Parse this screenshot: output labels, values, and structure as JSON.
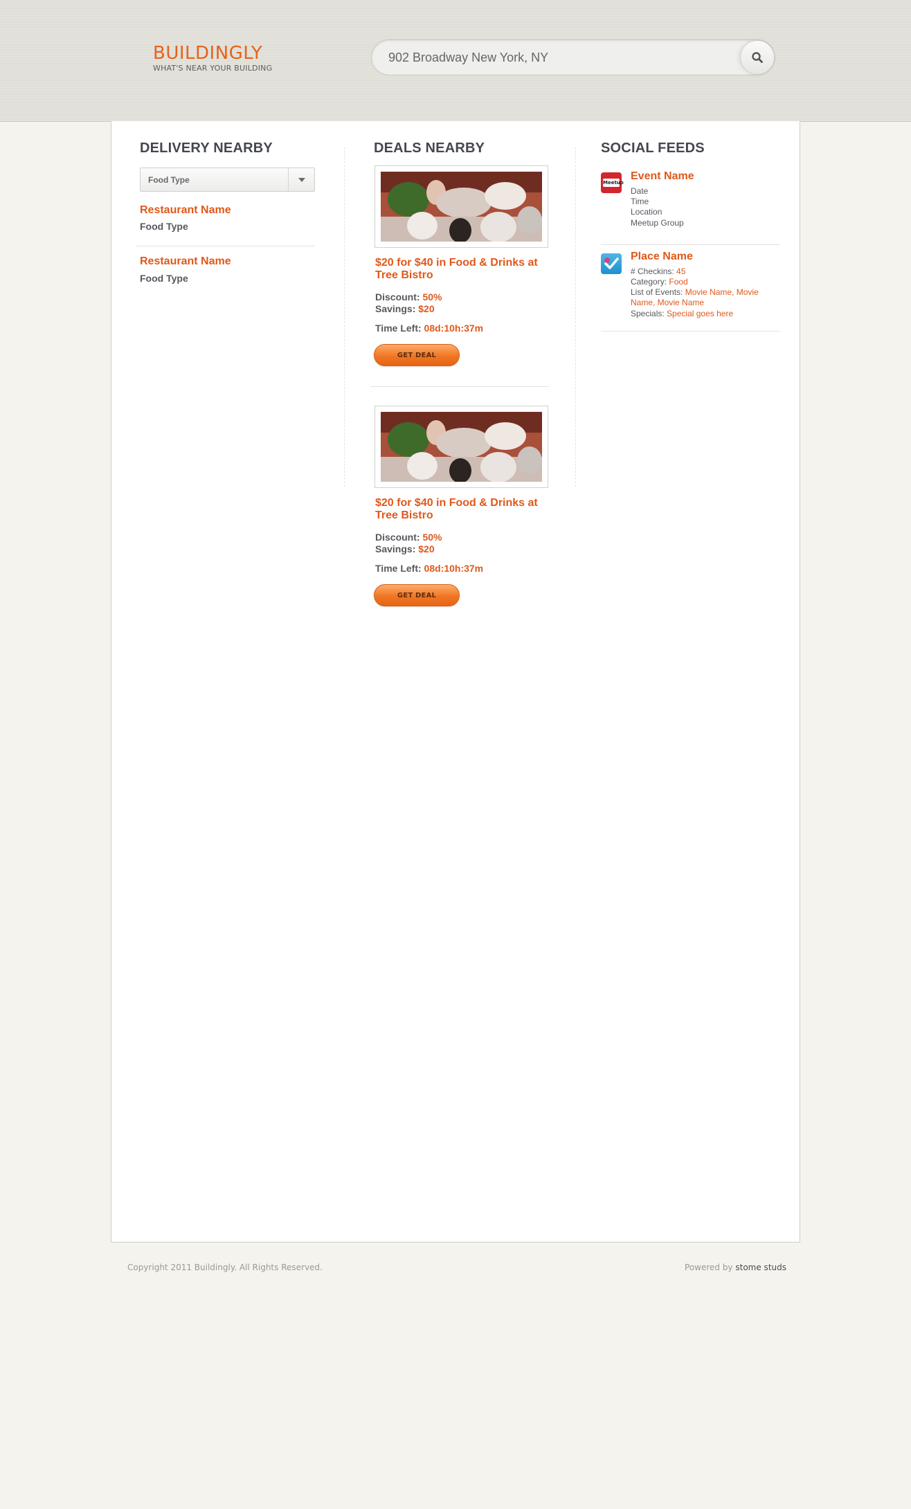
{
  "header": {
    "logo_title": "BUILDINGLY",
    "logo_tagline": "WHAT'S NEAR YOUR BUILDING",
    "search_value": "902 Broadway New York, NY",
    "search_icon": "search-icon"
  },
  "delivery": {
    "title": "DELIVERY NEARBY",
    "filter_label": "Food Type",
    "restaurants": [
      {
        "name": "Restaurant Name",
        "type": "Food Type"
      },
      {
        "name": "Restaurant Name",
        "type": "Food Type"
      }
    ]
  },
  "deals": {
    "title": "DEALS NEARBY",
    "items": [
      {
        "title": "$20 for $40 in Food & Drinks at Tree Bistro",
        "discount_label": "Discount:",
        "discount": "50%",
        "savings_label": "Savings:",
        "savings": "$20",
        "time_left_label": "Time Left:",
        "time_left": "08d:10h:37m",
        "button": "GET DEAL"
      },
      {
        "title": "$20 for $40 in Food & Drinks at Tree Bistro",
        "discount_label": "Discount:",
        "discount": "50%",
        "savings_label": "Savings:",
        "savings": "$20",
        "time_left_label": "Time Left:",
        "time_left": "08d:10h:37m",
        "button": "GET DEAL"
      }
    ]
  },
  "social": {
    "title": "SOCIAL FEEDS",
    "event": {
      "icon": "meetup-icon",
      "icon_text": "Meetup",
      "name": "Event Name",
      "lines": [
        "Date",
        "Time",
        "Location",
        "Meetup Group"
      ]
    },
    "place": {
      "icon": "foursquare-icon",
      "name": "Place Name",
      "checkins_label": "# Checkins:",
      "checkins": "45",
      "category_label": "Category:",
      "category": "Food",
      "events_label": "List of Events:",
      "events": "Movie Name, Movie Name, Movie Name",
      "specials_label": "Specials:",
      "specials": "Special goes here"
    }
  },
  "footer": {
    "copyright": "Copyright 2011 Buildingly.  All Rights Reserved.",
    "powered_label": "Powered by",
    "powered_brand": "stome studs"
  },
  "colors": {
    "accent": "#e0581a",
    "header_bg": "#e3e2dc",
    "page_bg": "#f4f3ee"
  }
}
